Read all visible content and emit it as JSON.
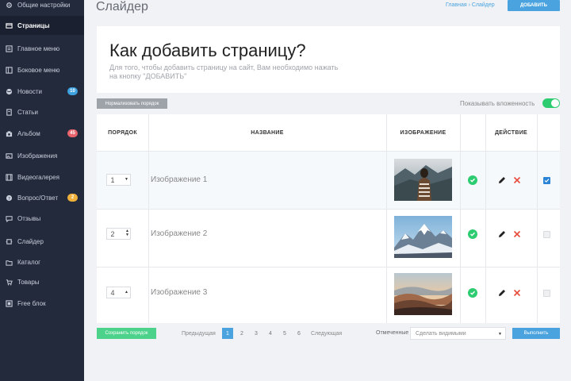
{
  "sidebar": {
    "items": [
      {
        "label": "Общие настройки",
        "icon": "gear-icon"
      },
      {
        "label": "Страницы",
        "icon": "pages-icon",
        "active": true
      },
      {
        "label": "Главное меню",
        "icon": "menu-icon"
      },
      {
        "label": "Боковое меню",
        "icon": "side-menu-icon"
      },
      {
        "label": "Новости",
        "icon": "globe-icon",
        "badge": "10",
        "badge_color": "#3ea1e0"
      },
      {
        "label": "Статьи",
        "icon": "article-icon"
      },
      {
        "label": "Альбом",
        "icon": "camera-icon",
        "badge": "45",
        "badge_color": "#e8636b"
      },
      {
        "label": "Изображения",
        "icon": "image-icon"
      },
      {
        "label": "Видеогалерея",
        "icon": "video-icon"
      },
      {
        "label": "Вопрос/Ответ",
        "icon": "question-icon",
        "badge": "2",
        "badge_color": "#f0b13c"
      },
      {
        "label": "Отзывы",
        "icon": "comment-icon"
      },
      {
        "label": "Слайдер",
        "icon": "slider-icon"
      },
      {
        "label": "Каталог",
        "icon": "catalog-icon"
      },
      {
        "label": "Товары",
        "icon": "cart-icon"
      },
      {
        "label": "Free блок",
        "icon": "block-icon"
      }
    ]
  },
  "header": {
    "title": "Слайдер",
    "breadcrumb": "Главная › Слайдер",
    "add_button": "ДОБАВИТЬ"
  },
  "intro": {
    "heading": "Как добавить страницу?",
    "text": "Для того, чтобы добавить страницу на сайт, Вам необходимо нажать на кнопку \"ДОБАВИТЬ\""
  },
  "toolbar": {
    "normalize_button": "Нормализовать порядок",
    "nesting_label": "Показывать вложенность",
    "nesting_enabled": true
  },
  "table": {
    "headers": {
      "order": "ПОРЯДОК",
      "name": "НАЗВАНИЕ",
      "image": "ИЗОБРАЖЕНИЕ",
      "action": "ДЕЙСТВИЕ"
    },
    "rows": [
      {
        "order": "1",
        "stepper": "▼",
        "name": "Изображение 1",
        "image": "woman-mountains-photo",
        "published": true,
        "checked": true
      },
      {
        "order": "2",
        "stepper": "▲▼",
        "name": "Изображение 2",
        "image": "snowy-mountains-photo",
        "published": true,
        "checked": false
      },
      {
        "order": "4",
        "stepper": "▲",
        "name": "Изображение 3",
        "image": "desert-hills-photo",
        "published": true,
        "checked": false
      }
    ]
  },
  "footer": {
    "save_button": "Сохранить порядок",
    "prev_label": "Предыдущая",
    "next_label": "Следующая",
    "pages": [
      "1",
      "2",
      "3",
      "4",
      "5",
      "6"
    ],
    "current_page": "1",
    "marked_label": "Отмеченные",
    "select_value": "Сделать видимыми",
    "run_button": "Выполнить"
  },
  "colors": {
    "sidebar_bg": "#232a3b",
    "accent": "#4aa3df",
    "success": "#2ecc71",
    "danger": "#e74c3c"
  }
}
